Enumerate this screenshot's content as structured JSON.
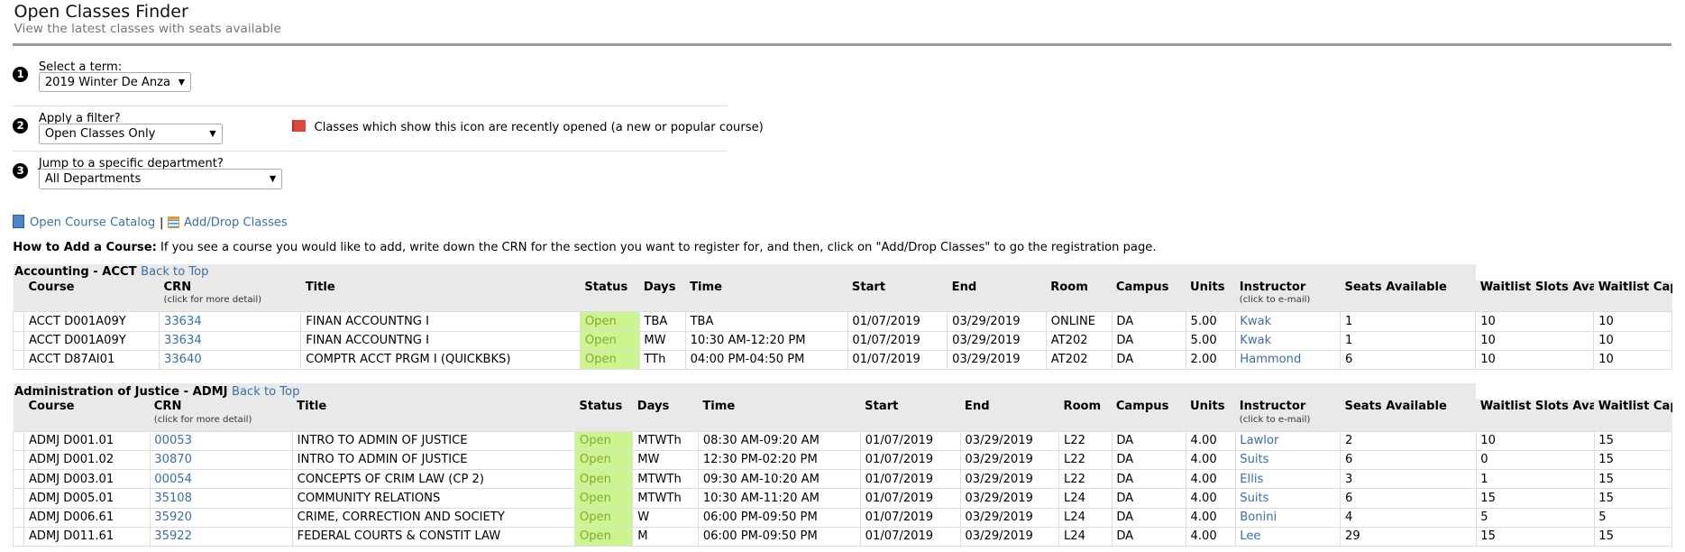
{
  "header": {
    "title": "Open Classes Finder",
    "subtitle": "View the latest classes with seats available"
  },
  "steps": [
    {
      "num": "1",
      "label": "Select a term:",
      "value": "2019 Winter De Anza"
    },
    {
      "num": "2",
      "label": "Apply a filter?",
      "value": "Open Classes Only"
    },
    {
      "num": "3",
      "label": "Jump to a specific department?",
      "value": "All Departments"
    }
  ],
  "flag_note": "Classes which show this icon are recently opened (a new or popular course)",
  "links": {
    "catalog": "Open Course Catalog",
    "separator": "|",
    "add_drop": "Add/Drop Classes"
  },
  "howto": {
    "label": "How to Add a Course:",
    "text": " If you see a course you would like to add, write down the CRN for the section you want to register for, and then, click on \"Add/Drop Classes\" to go the registration page."
  },
  "columns": [
    "Course",
    "CRN",
    "Title",
    "Status",
    "Days",
    "Time",
    "Start",
    "End",
    "Room",
    "Campus",
    "Units",
    "Instructor",
    "Seats Available",
    "Waitlist Slots Available",
    "Waitlist Capacity"
  ],
  "column_notes": {
    "crn": "(click for more detail)",
    "instructor": "(click to e-mail)"
  },
  "back_to_top": "Back to Top",
  "colors": {
    "link": "#3b6ea5",
    "open_bg": "#ccf590",
    "header_bg": "#e9e9e9"
  },
  "departments": [
    {
      "name": "Accounting - ACCT",
      "rows": [
        [
          "ACCT D001A09Y",
          "33634",
          "FINAN ACCOUNTNG I",
          "Open",
          "TBA",
          "TBA",
          "01/07/2019",
          "03/29/2019",
          "ONLINE",
          "DA",
          "5.00",
          "Kwak",
          "1",
          "10",
          "10"
        ],
        [
          "ACCT D001A09Y",
          "33634",
          "FINAN ACCOUNTNG I",
          "Open",
          "MW",
          "10:30 AM-12:20 PM",
          "01/07/2019",
          "03/29/2019",
          "AT202",
          "DA",
          "5.00",
          "Kwak",
          "1",
          "10",
          "10"
        ],
        [
          "ACCT D87AI01",
          "33640",
          "COMPTR ACCT PRGM I (QUICKBKS)",
          "Open",
          "TTh",
          "04:00 PM-04:50 PM",
          "01/07/2019",
          "03/29/2019",
          "AT202",
          "DA",
          "2.00",
          "Hammond",
          "6",
          "10",
          "10"
        ]
      ]
    },
    {
      "name": "Administration of Justice - ADMJ",
      "rows": [
        [
          "ADMJ D001.01",
          "00053",
          "INTRO TO ADMIN OF JUSTICE",
          "Open",
          "MTWTh",
          "08:30 AM-09:20 AM",
          "01/07/2019",
          "03/29/2019",
          "L22",
          "DA",
          "4.00",
          "Lawlor",
          "2",
          "10",
          "15"
        ],
        [
          "ADMJ D001.02",
          "30870",
          "INTRO TO ADMIN OF JUSTICE",
          "Open",
          "MW",
          "12:30 PM-02:20 PM",
          "01/07/2019",
          "03/29/2019",
          "L22",
          "DA",
          "4.00",
          "Suits",
          "6",
          "0",
          "15"
        ],
        [
          "ADMJ D003.01",
          "00054",
          "CONCEPTS OF CRIM LAW (CP 2)",
          "Open",
          "MTWTh",
          "09:30 AM-10:20 AM",
          "01/07/2019",
          "03/29/2019",
          "L22",
          "DA",
          "4.00",
          "Ellis",
          "3",
          "1",
          "15"
        ],
        [
          "ADMJ D005.01",
          "35108",
          "COMMUNITY RELATIONS",
          "Open",
          "MTWTh",
          "10:30 AM-11:20 AM",
          "01/07/2019",
          "03/29/2019",
          "L24",
          "DA",
          "4.00",
          "Suits",
          "6",
          "15",
          "15"
        ],
        [
          "ADMJ D006.61",
          "35920",
          "CRIME, CORRECTION AND SOCIETY",
          "Open",
          "W",
          "06:00 PM-09:50 PM",
          "01/07/2019",
          "03/29/2019",
          "L24",
          "DA",
          "4.00",
          "Bonini",
          "4",
          "5",
          "5"
        ],
        [
          "ADMJ D011.61",
          "35922",
          "FEDERAL COURTS & CONSTIT LAW",
          "Open",
          "M",
          "06:00 PM-09:50 PM",
          "01/07/2019",
          "03/29/2019",
          "L24",
          "DA",
          "4.00",
          "Lee",
          "29",
          "15",
          "15"
        ]
      ]
    }
  ]
}
